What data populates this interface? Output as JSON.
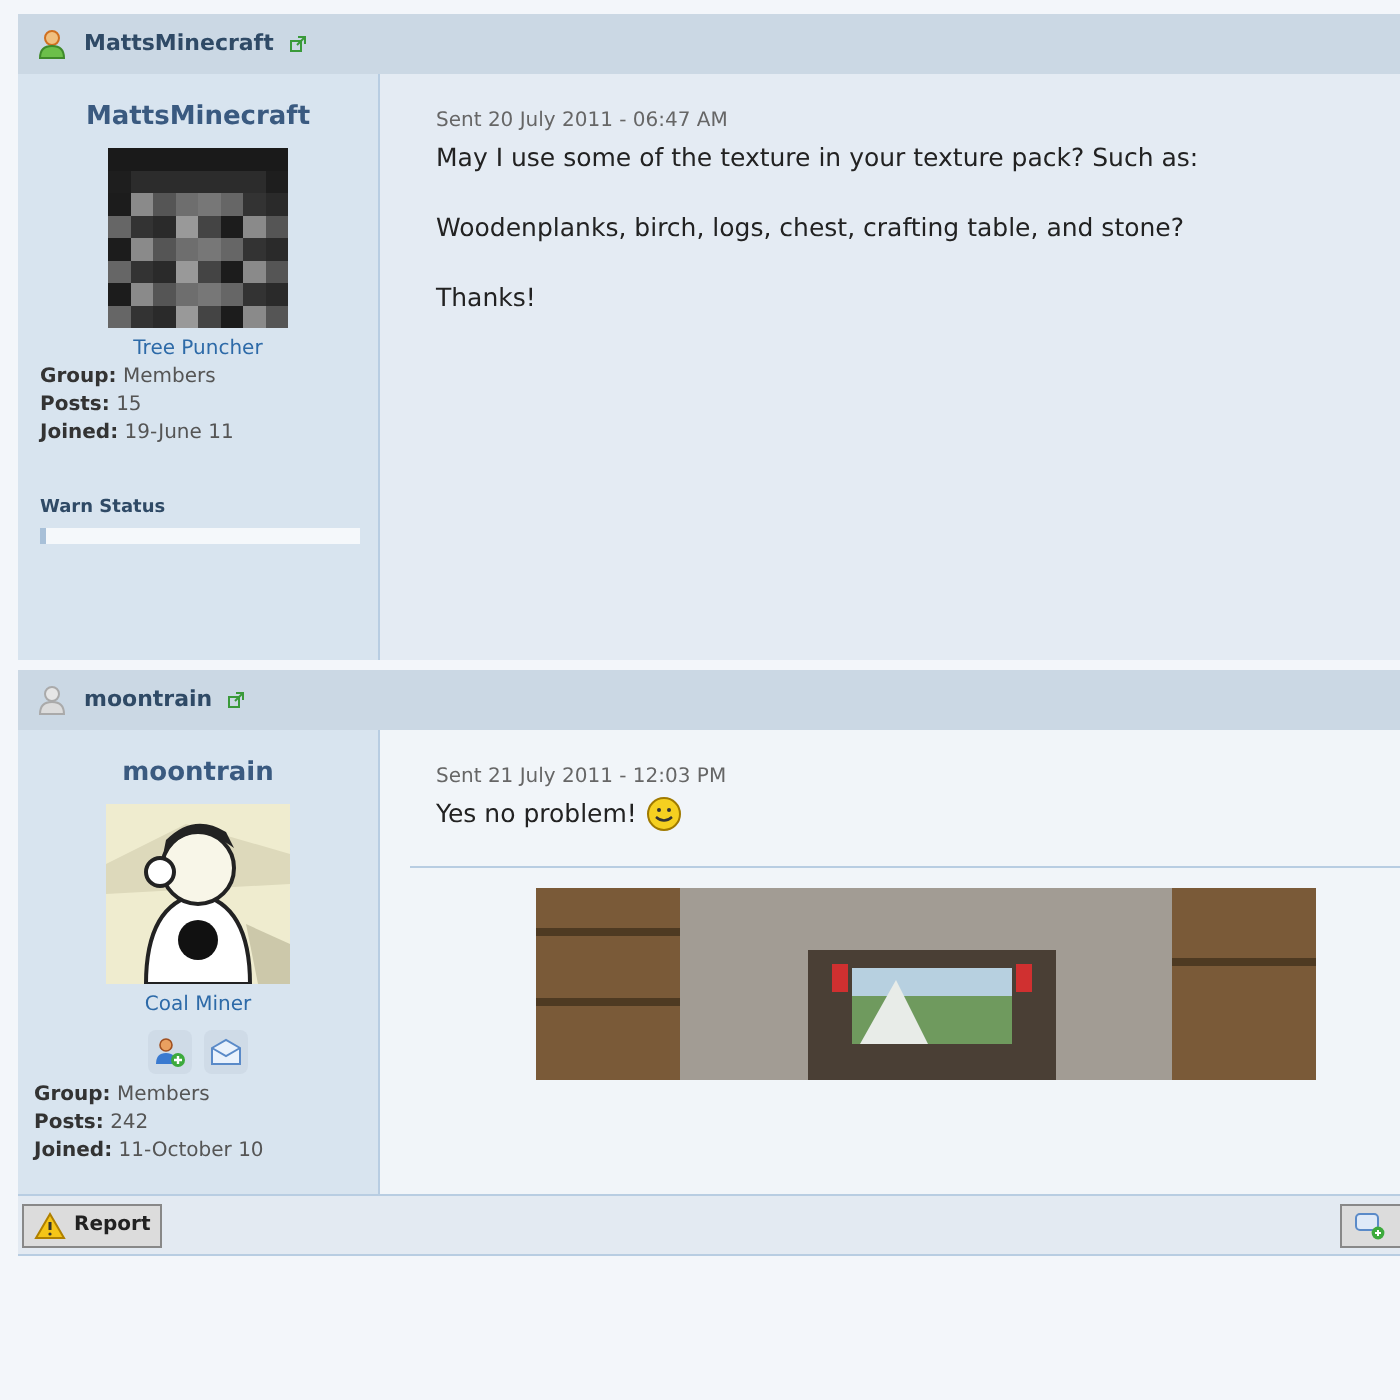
{
  "posts": [
    {
      "header_name": "MattsMinecraft",
      "online": true,
      "name": "MattsMinecraft",
      "rank": "Tree Puncher",
      "contact_buttons": false,
      "fields": [
        {
          "label": "Group:",
          "value": "Members"
        },
        {
          "label": "Posts:",
          "value": "15"
        },
        {
          "label": "Joined:",
          "value": "19-June 11"
        }
      ],
      "warn": {
        "label": "Warn Status",
        "level": 0.02
      },
      "sent": "Sent 20 July 2011 - 06:47 AM",
      "paragraphs": [
        "May I use some of the texture in your texture pack? Such as:",
        "Woodenplanks, birch, logs, chest, crafting table, and stone?",
        "Thanks!"
      ],
      "smiley": false,
      "signature": false
    },
    {
      "header_name": "moontrain",
      "online": false,
      "name": "moontrain",
      "rank": "Coal Miner",
      "contact_buttons": true,
      "fields": [
        {
          "label": "Group:",
          "value": "Members"
        },
        {
          "label": "Posts:",
          "value": "242"
        },
        {
          "label": "Joined:",
          "value": "11-October 10"
        }
      ],
      "sent": "Sent 21 July 2011 - 12:03 PM",
      "paragraphs": [
        "Yes no problem!"
      ],
      "smiley": true,
      "signature": true
    }
  ],
  "footer": {
    "report": "Report"
  }
}
